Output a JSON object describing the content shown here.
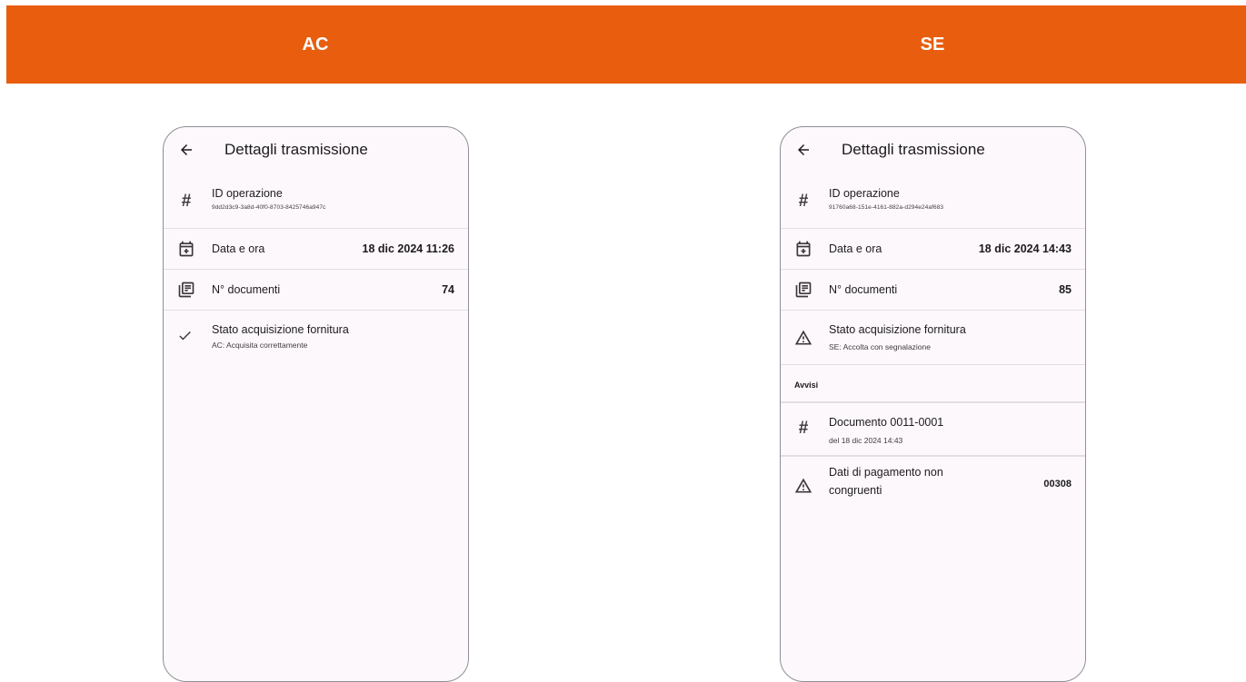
{
  "banner": {
    "left_label": "AC",
    "right_label": "SE",
    "color": "#e85d0e"
  },
  "screens": [
    {
      "title": "Dettagli trasmissione",
      "id_label": "ID operazione",
      "id_value": "9dd2d3c9-3a8d-40f0-8703-8425746a947c",
      "date_label": "Data e ora",
      "date_value": "18 dic 2024 11:26",
      "docs_label": "N° documenti",
      "docs_value": "74",
      "status_label": "Stato acquisizione fornitura",
      "status_value": "AC: Acquisita correttamente",
      "status_icon": "check-icon"
    },
    {
      "title": "Dettagli trasmissione",
      "id_label": "ID operazione",
      "id_value": "91760a68-151e-4161-882a-d294e24af683",
      "date_label": "Data e ora",
      "date_value": "18 dic 2024 14:43",
      "docs_label": "N° documenti",
      "docs_value": "85",
      "status_label": "Stato acquisizione fornitura",
      "status_value": "SE: Accolta con segnalazione",
      "status_icon": "warning-icon",
      "warnings_header": "Avvisi",
      "warnings": [
        {
          "title": "Documento 0011-0001",
          "subtitle": "del 18 dic 2024 14:43",
          "icon": "hash-icon"
        },
        {
          "title_line1": "Dati di pagamento non",
          "title_line2": "congruenti",
          "code": "00308",
          "icon": "warning-icon"
        }
      ]
    }
  ]
}
